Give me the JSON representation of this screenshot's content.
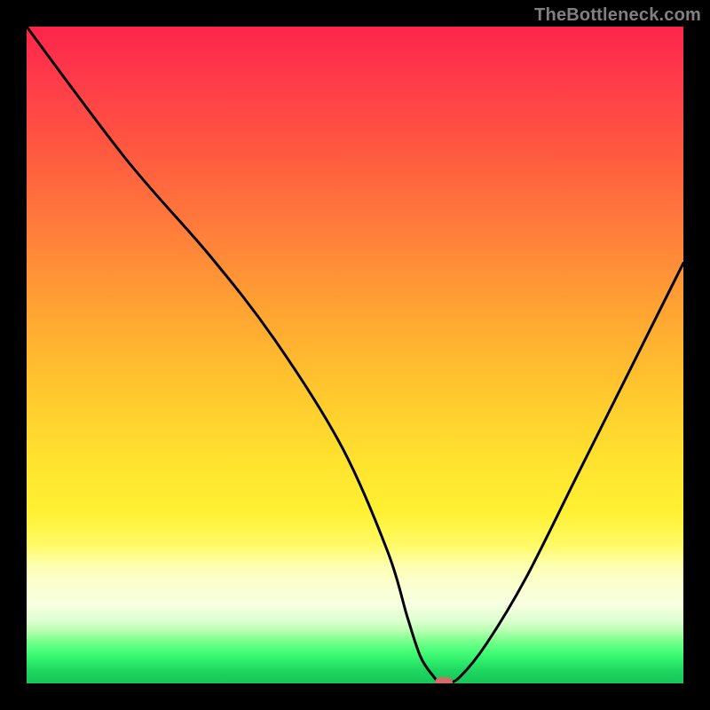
{
  "watermark": "TheBottleneck.com",
  "chart_data": {
    "type": "line",
    "title": "",
    "xlabel": "",
    "ylabel": "",
    "xlim": [
      0,
      100
    ],
    "ylim": [
      0,
      100
    ],
    "grid": false,
    "legend": false,
    "background_gradient": {
      "stops": [
        {
          "pos": 0.0,
          "color": "#fc2549"
        },
        {
          "pos": 0.3,
          "color": "#ff7a3b"
        },
        {
          "pos": 0.55,
          "color": "#ffc62e"
        },
        {
          "pos": 0.74,
          "color": "#fff133"
        },
        {
          "pos": 0.88,
          "color": "#f7ffe0"
        },
        {
          "pos": 0.95,
          "color": "#4bff79"
        },
        {
          "pos": 1.0,
          "color": "#16c558"
        }
      ]
    },
    "series": [
      {
        "name": "bottleneck-curve",
        "x": [
          0,
          15,
          28,
          38,
          48,
          55,
          58,
          60,
          62,
          63,
          64,
          66,
          70,
          76,
          84,
          92,
          100
        ],
        "values": [
          100,
          80,
          65,
          52,
          36,
          20,
          10,
          4,
          1,
          0,
          0,
          1,
          6,
          16,
          32,
          48,
          64
        ]
      }
    ],
    "marker": {
      "x": 63.5,
      "y": 0,
      "color": "#d46a6a"
    }
  }
}
